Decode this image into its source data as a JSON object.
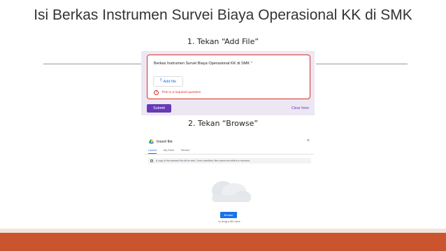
{
  "slide": {
    "title": "Isi Berkas Instrumen Survei Biaya Operasional KK di SMK",
    "step1": "1. Tekan “Add File”",
    "step2": "2. Tekan “Browse”",
    "accent_color": "#c9542d"
  },
  "form": {
    "question": "Berkas Instrumen Survei Biaya Operasional KK di SMK",
    "required_marker": "*",
    "add_file_label": "Add file",
    "error_text": "This is a required question",
    "submit_label": "Submit",
    "clear_label": "Clear form",
    "colors": {
      "primary": "#673ab7",
      "error": "#d93025",
      "link": "#1a73e8"
    }
  },
  "picker": {
    "title": "Insert file",
    "close": "×",
    "tabs": [
      "Upload",
      "My Drive",
      "Recent"
    ],
    "info": "A copy of the selected file will be sent. Once submitted, files cannot be edited or removed.",
    "browse_label": "Browse",
    "drag_text": "or drag a file here"
  }
}
